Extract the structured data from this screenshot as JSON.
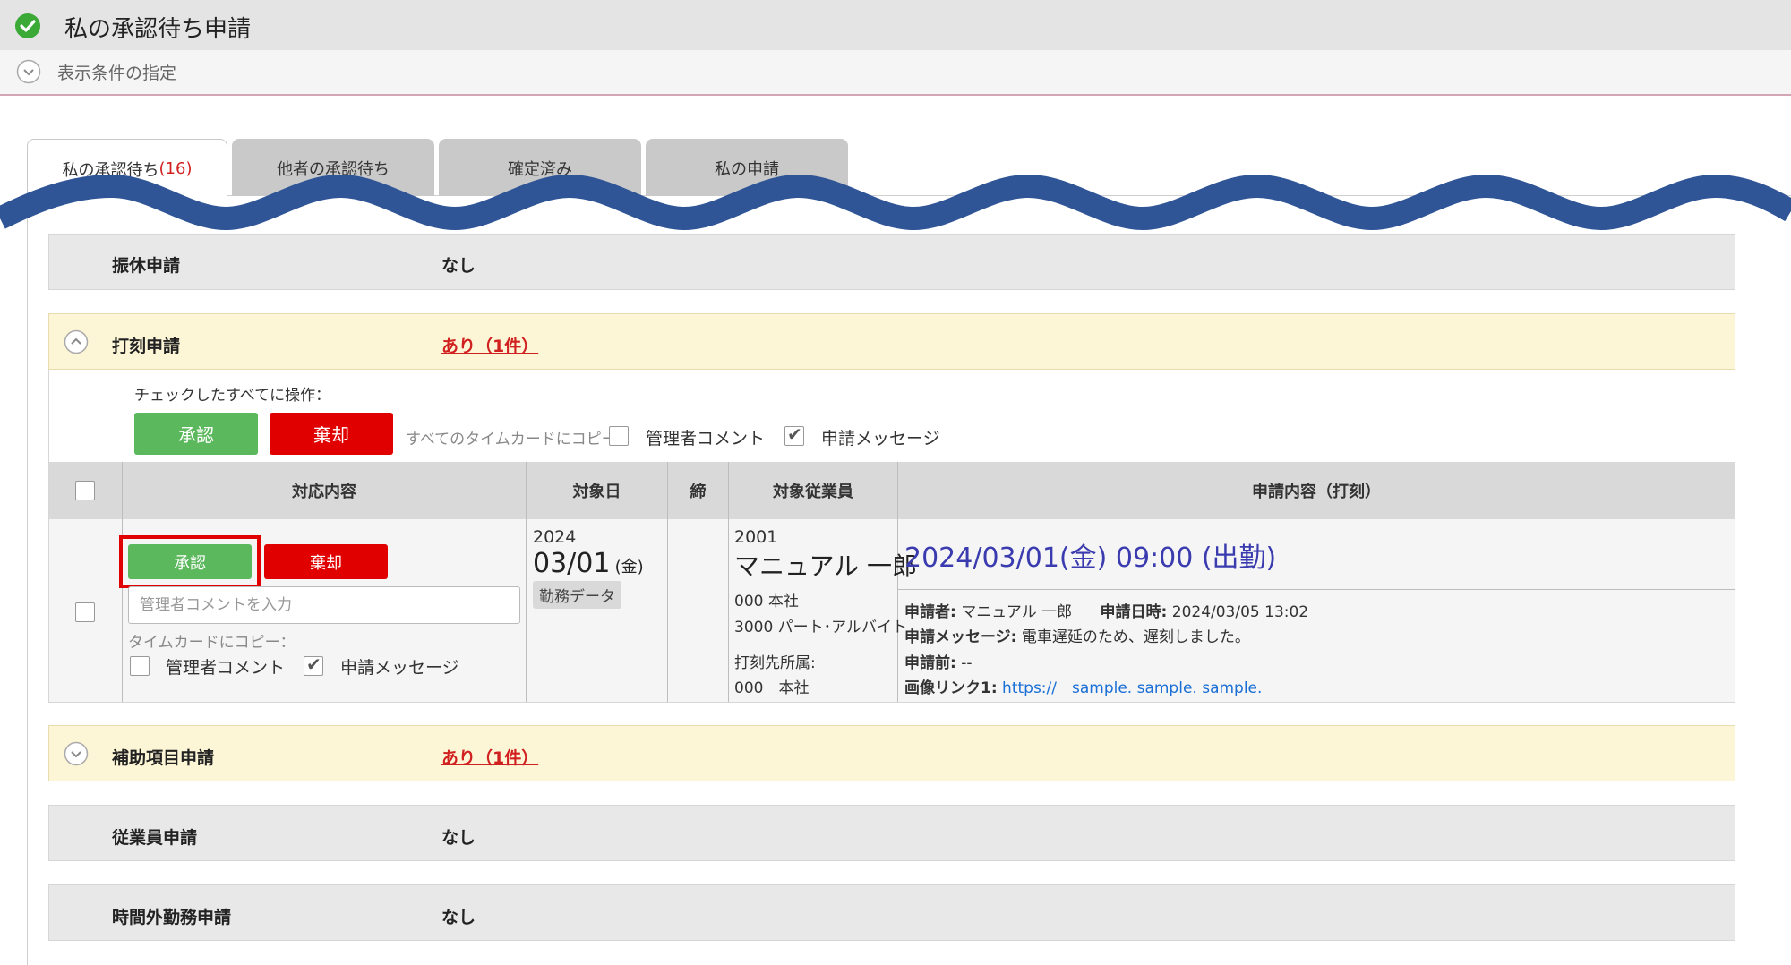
{
  "header": {
    "title": "私の承認待ち申請",
    "condition_label": "表示条件の指定"
  },
  "tabs": [
    {
      "label": "私の承認待ち",
      "count": "(16)"
    },
    {
      "label": "他者の承認待ち"
    },
    {
      "label": "確定済み"
    },
    {
      "label": "私の申請"
    }
  ],
  "sections": {
    "furikyu": {
      "label": "振休申請",
      "status": "なし"
    },
    "dakoku": {
      "label": "打刻申請",
      "status": "あり（1件）"
    },
    "hojo": {
      "label": "補助項目申請",
      "status": "あり（1件）"
    },
    "employee": {
      "label": "従業員申請",
      "status": "なし"
    },
    "overtime": {
      "label": "時間外勤務申請",
      "status": "なし"
    }
  },
  "bulk": {
    "label": "チェックしたすべてに操作：",
    "approve": "承認",
    "reject": "棄却",
    "copy_label": "すべてのタイムカードにコピー：",
    "admin_comment": "管理者コメント",
    "request_message": "申請メッセージ"
  },
  "table": {
    "headers": [
      "対応内容",
      "対象日",
      "締",
      "対象従業員",
      "申請内容（打刻）"
    ],
    "row": {
      "approve": "承認",
      "reject": "棄却",
      "comment_placeholder": "管理者コメントを入力",
      "copy_label": "タイムカードにコピー：",
      "admin_comment": "管理者コメント",
      "request_message": "申請メッセージ",
      "year": "2024",
      "date": "03/01",
      "weekday": "(金)",
      "work_data": "勤務データ",
      "emp_code": "2001",
      "emp_name": "マニュアル 一郎",
      "dept": "000 本社",
      "type": "3000 パート･アルバイト",
      "stamp_dept_label": "打刻先所属:",
      "stamp_dept": "000　本社",
      "req_title": "2024/03/01(金) 09:00 (出勤)",
      "applicant_label": "申請者:",
      "applicant": "マニュアル 一郎",
      "applied_at_label": "申請日時:",
      "applied_at": "2024/03/05 13:02",
      "message_label": "申請メッセージ:",
      "message": "電車遅延のため、遅刻しました。",
      "before_label": "申請前:",
      "before": "--",
      "image_link_label": "画像リンク1:",
      "image_link": "https://　sample. sample. sample."
    }
  },
  "colors": {
    "approve": "#5cb85c",
    "reject": "#e00000",
    "wave": "#2f5597",
    "highlight": "#e00000"
  }
}
